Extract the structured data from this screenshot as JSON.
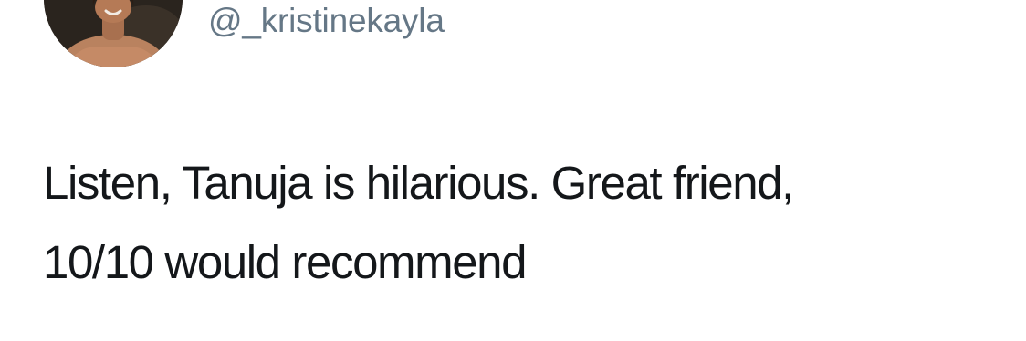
{
  "tweet": {
    "handle": "@_kristinekayla",
    "text_lines": [
      "Listen, Tanuja is hilarious. Great friend,",
      "10/10 would recommend"
    ]
  },
  "colors": {
    "background": "#ffffff",
    "handle": "#657786",
    "text": "#14171a"
  }
}
